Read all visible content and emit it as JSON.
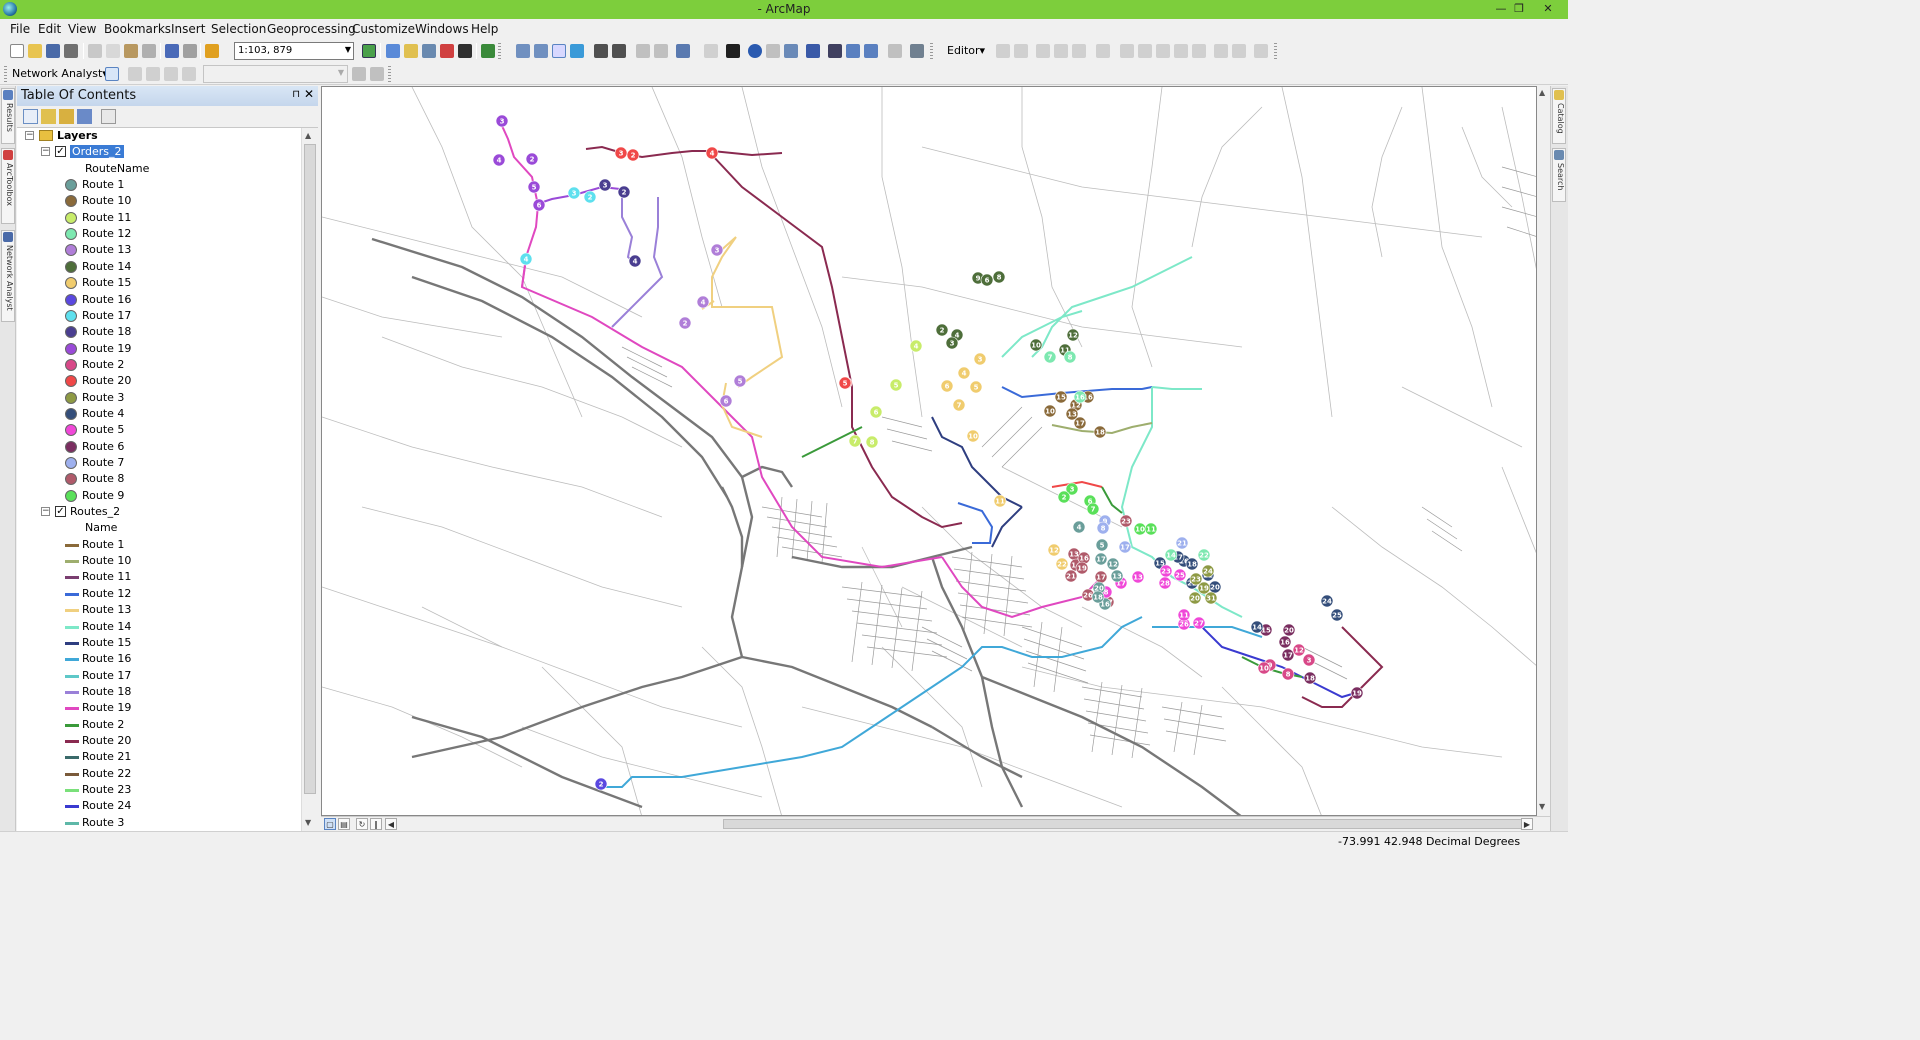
{
  "window": {
    "title": "- ArcMap",
    "minimize_glyph": "—",
    "restore_glyph": "❐",
    "close_glyph": "✕"
  },
  "menu": [
    "File",
    "Edit",
    "View",
    "Bookmarks",
    "Insert",
    "Selection",
    "Geoprocessing",
    "Customize",
    "Windows",
    "Help"
  ],
  "toolbar": {
    "scale": "1:103, 879",
    "editor_label": "Editor▾",
    "network_analyst_label": "Network Analyst▾"
  },
  "left_tabs": [
    "Results",
    "ArcToolbox",
    "Network Analyst"
  ],
  "right_tabs": [
    "Catalog",
    "Search"
  ],
  "toc": {
    "title": "Table Of Contents",
    "pin_glyph": "⊓",
    "close_glyph": "✕",
    "root_label": "Layers",
    "layers": [
      {
        "name": "Orders_2",
        "field": "RouteName",
        "kind": "point",
        "classes": [
          {
            "label": "Route 1",
            "color": "#6a9e9a"
          },
          {
            "label": "Route 10",
            "color": "#8a6a3a"
          },
          {
            "label": "Route 11",
            "color": "#c8ec6a"
          },
          {
            "label": "Route 12",
            "color": "#7de8b0"
          },
          {
            "label": "Route 13",
            "color": "#b07ed8"
          },
          {
            "label": "Route 14",
            "color": "#4e6e3a"
          },
          {
            "label": "Route 15",
            "color": "#f0cc6e"
          },
          {
            "label": "Route 16",
            "color": "#5a48e0"
          },
          {
            "label": "Route 17",
            "color": "#5ee0ee"
          },
          {
            "label": "Route 18",
            "color": "#4a3e90"
          },
          {
            "label": "Route 19",
            "color": "#9a4ad8"
          },
          {
            "label": "Route 2",
            "color": "#d84888"
          },
          {
            "label": "Route 20",
            "color": "#f04848"
          },
          {
            "label": "Route 3",
            "color": "#8e9a44"
          },
          {
            "label": "Route 4",
            "color": "#344e7a"
          },
          {
            "label": "Route 5",
            "color": "#f048d8"
          },
          {
            "label": "Route 6",
            "color": "#7a2e60"
          },
          {
            "label": "Route 7",
            "color": "#9eb0ee"
          },
          {
            "label": "Route 8",
            "color": "#b05a6a"
          },
          {
            "label": "Route 9",
            "color": "#5ae05a"
          }
        ]
      },
      {
        "name": "Routes_2",
        "field": "Name",
        "kind": "line",
        "classes": [
          {
            "label": "Route 1",
            "color": "#8a6a3a"
          },
          {
            "label": "Route 10",
            "color": "#9eae6e"
          },
          {
            "label": "Route 11",
            "color": "#7a3e70"
          },
          {
            "label": "Route 12",
            "color": "#3a6ad8"
          },
          {
            "label": "Route 13",
            "color": "#f0d080"
          },
          {
            "label": "Route 14",
            "color": "#7de8c8"
          },
          {
            "label": "Route 15",
            "color": "#2e3e80"
          },
          {
            "label": "Route 16",
            "color": "#40a8d8"
          },
          {
            "label": "Route 17",
            "color": "#5ec8c8"
          },
          {
            "label": "Route 18",
            "color": "#9a80d8"
          },
          {
            "label": "Route 19",
            "color": "#e048c0"
          },
          {
            "label": "Route 2",
            "color": "#3a9a3a"
          },
          {
            "label": "Route 20",
            "color": "#8a2a50"
          },
          {
            "label": "Route 21",
            "color": "#3a6a6a"
          },
          {
            "label": "Route 22",
            "color": "#7a5a3a"
          },
          {
            "label": "Route 23",
            "color": "#7ae07a"
          },
          {
            "label": "Route 24",
            "color": "#3a3ad0"
          },
          {
            "label": "Route 3",
            "color": "#5eb8a8"
          }
        ]
      }
    ]
  },
  "status": {
    "coordinates": "-73.991  42.948 Decimal Degrees"
  },
  "map": {
    "stops": [
      {
        "n": "3",
        "c": "#9a4ad8"
      },
      {
        "n": "4",
        "c": "#9a4ad8"
      },
      {
        "n": "2",
        "c": "#9a4ad8"
      },
      {
        "n": "5",
        "c": "#9a4ad8"
      },
      {
        "n": "6",
        "c": "#9a4ad8"
      },
      {
        "n": "3",
        "c": "#5ee0ee"
      },
      {
        "n": "2",
        "c": "#5ee0ee"
      },
      {
        "n": "4",
        "c": "#5ee0ee"
      },
      {
        "n": "3",
        "c": "#4a3e90"
      },
      {
        "n": "2",
        "c": "#4a3e90"
      },
      {
        "n": "4",
        "c": "#4a3e90"
      },
      {
        "n": "3",
        "c": "#f04848"
      },
      {
        "n": "2",
        "c": "#f04848"
      },
      {
        "n": "4",
        "c": "#f04848"
      },
      {
        "n": "5",
        "c": "#f04848"
      },
      {
        "n": "3",
        "c": "#b07ed8"
      },
      {
        "n": "4",
        "c": "#b07ed8"
      },
      {
        "n": "2",
        "c": "#b07ed8"
      },
      {
        "n": "5",
        "c": "#b07ed8"
      },
      {
        "n": "6",
        "c": "#b07ed8"
      },
      {
        "n": "9",
        "c": "#4e6e3a"
      },
      {
        "n": "6",
        "c": "#4e6e3a"
      },
      {
        "n": "8",
        "c": "#4e6e3a"
      },
      {
        "n": "2",
        "c": "#4e6e3a"
      },
      {
        "n": "4",
        "c": "#4e6e3a"
      },
      {
        "n": "3",
        "c": "#4e6e3a"
      },
      {
        "n": "12",
        "c": "#4e6e3a"
      },
      {
        "n": "11",
        "c": "#4e6e3a"
      },
      {
        "n": "10",
        "c": "#4e6e3a"
      },
      {
        "n": "3",
        "c": "#f0cc6e"
      },
      {
        "n": "4",
        "c": "#f0cc6e"
      },
      {
        "n": "5",
        "c": "#f0cc6e"
      },
      {
        "n": "6",
        "c": "#f0cc6e"
      },
      {
        "n": "7",
        "c": "#f0cc6e"
      },
      {
        "n": "10",
        "c": "#f0cc6e"
      },
      {
        "n": "11",
        "c": "#f0cc6e"
      },
      {
        "n": "4",
        "c": "#c8ec6a"
      },
      {
        "n": "5",
        "c": "#c8ec6a"
      },
      {
        "n": "6",
        "c": "#c8ec6a"
      },
      {
        "n": "7",
        "c": "#c8ec6a"
      },
      {
        "n": "8",
        "c": "#c8ec6a"
      },
      {
        "n": "15",
        "c": "#8a6a3a"
      },
      {
        "n": "16",
        "c": "#8a6a3a"
      },
      {
        "n": "10",
        "c": "#8a6a3a"
      },
      {
        "n": "12",
        "c": "#8a6a3a"
      },
      {
        "n": "13",
        "c": "#8a6a3a"
      },
      {
        "n": "17",
        "c": "#8a6a3a"
      },
      {
        "n": "18",
        "c": "#8a6a3a"
      },
      {
        "n": "5",
        "c": "#f04848"
      },
      {
        "n": "2",
        "c": "#5a48e0"
      },
      {
        "n": "20",
        "c": "#7a2e60"
      },
      {
        "n": "19",
        "c": "#7a2e60"
      },
      {
        "n": "15",
        "c": "#7a2e60"
      },
      {
        "n": "16",
        "c": "#7a2e60"
      },
      {
        "n": "17",
        "c": "#7a2e60"
      },
      {
        "n": "18",
        "c": "#7a2e60"
      },
      {
        "n": "3",
        "c": "#d84888"
      },
      {
        "n": "8",
        "c": "#d84888"
      },
      {
        "n": "9",
        "c": "#d84888"
      },
      {
        "n": "10",
        "c": "#d84888"
      },
      {
        "n": "12",
        "c": "#d84888"
      },
      {
        "n": "24",
        "c": "#344e7a"
      },
      {
        "n": "25",
        "c": "#344e7a"
      },
      {
        "n": "14",
        "c": "#344e7a"
      },
      {
        "n": "20",
        "c": "#344e7a"
      },
      {
        "n": "22",
        "c": "#344e7a"
      },
      {
        "n": "21",
        "c": "#344e7a"
      },
      {
        "n": "23",
        "c": "#b05a6a"
      },
      {
        "n": "13",
        "c": "#b05a6a"
      },
      {
        "n": "14",
        "c": "#b05a6a"
      },
      {
        "n": "16",
        "c": "#b05a6a"
      },
      {
        "n": "17",
        "c": "#b05a6a"
      },
      {
        "n": "19",
        "c": "#b05a6a"
      },
      {
        "n": "21",
        "c": "#b05a6a"
      },
      {
        "n": "26",
        "c": "#b05a6a"
      },
      {
        "n": "27",
        "c": "#b05a6a"
      },
      {
        "n": "12",
        "c": "#f0cc6e"
      },
      {
        "n": "22",
        "c": "#f0cc6e"
      },
      {
        "n": "15",
        "c": "#344e7a"
      },
      {
        "n": "16",
        "c": "#344e7a"
      },
      {
        "n": "17",
        "c": "#344e7a"
      },
      {
        "n": "18",
        "c": "#344e7a"
      },
      {
        "n": "20",
        "c": "#8e9a44"
      },
      {
        "n": "19",
        "c": "#8e9a44"
      },
      {
        "n": "23",
        "c": "#8e9a44"
      },
      {
        "n": "24",
        "c": "#8e9a44"
      },
      {
        "n": "31",
        "c": "#8e9a44"
      },
      {
        "n": "23",
        "c": "#f048d8"
      },
      {
        "n": "25",
        "c": "#f048d8"
      },
      {
        "n": "28",
        "c": "#f048d8"
      },
      {
        "n": "13",
        "c": "#f048d8"
      },
      {
        "n": "17",
        "c": "#f048d8"
      },
      {
        "n": "8",
        "c": "#f048d8"
      },
      {
        "n": "26",
        "c": "#f048d8"
      },
      {
        "n": "27",
        "c": "#f048d8"
      },
      {
        "n": "11",
        "c": "#f048d8"
      },
      {
        "n": "10",
        "c": "#5ae05a"
      },
      {
        "n": "11",
        "c": "#5ae05a"
      },
      {
        "n": "3",
        "c": "#5ae05a"
      },
      {
        "n": "2",
        "c": "#5ae05a"
      },
      {
        "n": "6",
        "c": "#5ae05a"
      },
      {
        "n": "7",
        "c": "#5ae05a"
      },
      {
        "n": "9",
        "c": "#9eb0ee"
      },
      {
        "n": "8",
        "c": "#9eb0ee"
      },
      {
        "n": "17",
        "c": "#9eb0ee"
      },
      {
        "n": "21",
        "c": "#9eb0ee"
      },
      {
        "n": "4",
        "c": "#6a9e9a"
      },
      {
        "n": "5",
        "c": "#6a9e9a"
      },
      {
        "n": "17",
        "c": "#6a9e9a"
      },
      {
        "n": "20",
        "c": "#6a9e9a"
      },
      {
        "n": "16",
        "c": "#6a9e9a"
      },
      {
        "n": "18",
        "c": "#6a9e9a"
      },
      {
        "n": "13",
        "c": "#6a9e9a"
      },
      {
        "n": "12",
        "c": "#6a9e9a"
      },
      {
        "n": "14",
        "c": "#7de8b0"
      },
      {
        "n": "22",
        "c": "#7de8b0"
      },
      {
        "n": "7",
        "c": "#7de8b0"
      },
      {
        "n": "8",
        "c": "#7de8b0"
      },
      {
        "n": "16",
        "c": "#7de8b0"
      },
      {
        "n": "2",
        "c": "#5a48e0"
      }
    ]
  }
}
